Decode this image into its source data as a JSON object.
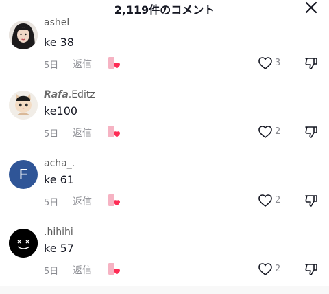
{
  "header": {
    "title": "2,119件のコメント",
    "close_icon": "close-icon"
  },
  "comments": [
    {
      "username": "ashel",
      "text": "ke 38",
      "date": "5日",
      "reply_label": "返信",
      "like_count": "3",
      "avatar": "photo"
    },
    {
      "username_styled": "Rafa",
      "username_rest": ".Editz",
      "text": "ke100",
      "date": "5日",
      "reply_label": "返信",
      "like_count": "2",
      "avatar": "cat-photo"
    },
    {
      "username": "acha_.",
      "avatar_letter": "F",
      "text": "ke 61",
      "date": "5日",
      "reply_label": "返信",
      "like_count": "2",
      "avatar_color": "#2f5597"
    },
    {
      "username": ".hihihi",
      "text": "ke 57",
      "date": "5日",
      "reply_label": "返信",
      "like_count": "2",
      "avatar": "smiley"
    }
  ],
  "colors": {
    "accent_pink": "#fe2c55",
    "secondary_text": "#8a8b91"
  }
}
